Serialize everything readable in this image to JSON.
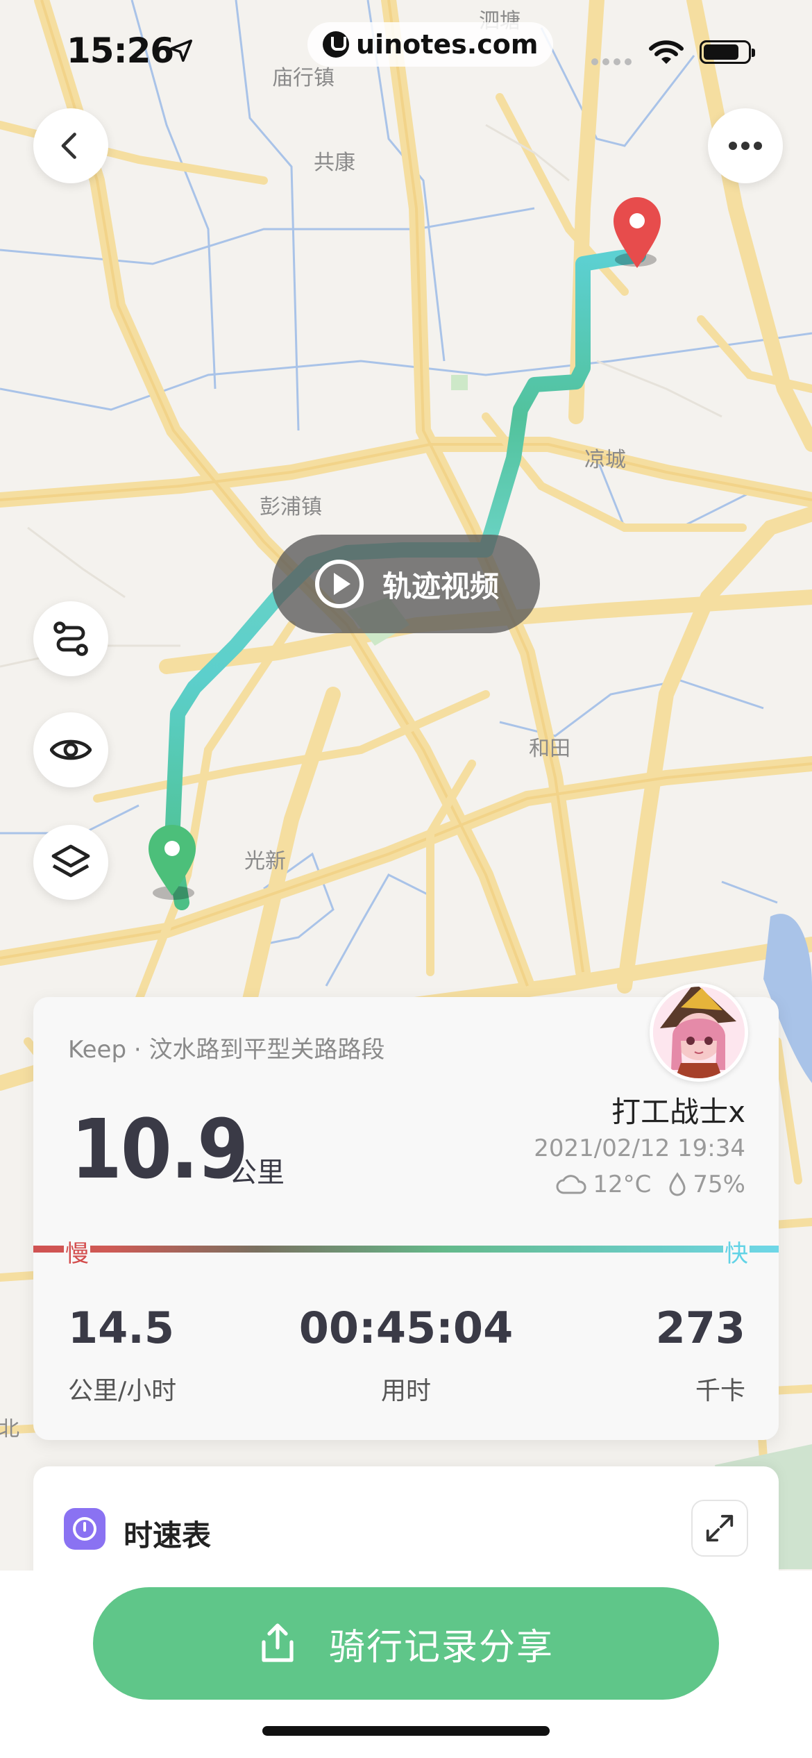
{
  "status_bar": {
    "time": "15:26",
    "watermark": "uinotes.com"
  },
  "map": {
    "place_labels": [
      "庙行镇",
      "共康",
      "泗塘",
      "凉城",
      "彭浦镇",
      "和田",
      "光新",
      "北"
    ],
    "video_button_label": "轨迹视频",
    "colors": {
      "route": "#5ecfcf",
      "route_start": "#58b886",
      "start_pin": "#4cbf7a",
      "end_pin": "#e74c4c"
    }
  },
  "controls": {
    "back_icon": "chevron-left-icon",
    "more_icon": "more-horizontal-icon",
    "side_icons": [
      "route-icon",
      "eye-icon",
      "layers-icon"
    ]
  },
  "summary": {
    "route_title": "Keep · 汶水路到平型关路路段",
    "distance": "10.9",
    "distance_unit": "公里",
    "username": "打工战士x",
    "datetime": "2021/02/12 19:34",
    "temperature": "12°C",
    "humidity": "75%",
    "speed_slow_label": "慢",
    "speed_fast_label": "快",
    "stats": [
      {
        "value": "14.5",
        "label": "公里/小时"
      },
      {
        "value": "00:45:04",
        "label": "用时"
      },
      {
        "value": "273",
        "label": "千卡"
      }
    ]
  },
  "speedometer": {
    "title": "时速表"
  },
  "share": {
    "label": "骑行记录分享"
  },
  "colors": {
    "accent_green": "#5fc689",
    "slow_red": "#d34d4d",
    "fast_cyan": "#62d3e6",
    "speedometer_purple": "#8a72f2"
  }
}
